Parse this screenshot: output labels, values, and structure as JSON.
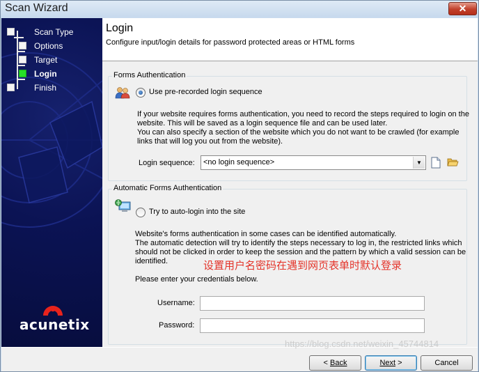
{
  "window": {
    "title": "Scan Wizard",
    "close_glyph": "✕"
  },
  "sidebar": {
    "steps": [
      {
        "label": "Scan Type",
        "active": false
      },
      {
        "label": "Options",
        "active": false
      },
      {
        "label": "Target",
        "active": false
      },
      {
        "label": "Login",
        "active": true
      },
      {
        "label": "Finish",
        "active": false
      }
    ],
    "logo_text": "acunetix"
  },
  "header": {
    "title": "Login",
    "subtitle": "Configure input/login details for password protected areas or HTML forms"
  },
  "forms_auth": {
    "legend": "Forms Authentication",
    "icon": "users-icon",
    "option_label": "Use pre-recorded login sequence",
    "option_selected": true,
    "description": [
      "If your website requires forms authentication, you need to record the steps required to login on the",
      "website. This will be saved as a login sequence file and can be used later.",
      "You can also specify a section of the website which you do not want to be crawled (for example",
      "links that will log you out from the website)."
    ],
    "sequence_label": "Login sequence:",
    "sequence_value": "<no login sequence>",
    "new_icon": "new-file-icon",
    "open_icon": "open-folder-icon"
  },
  "auto_auth": {
    "legend": "Automatic Forms Authentication",
    "icon": "computer-network-icon",
    "option_label": "Try to auto-login into the site",
    "option_selected": false,
    "description": [
      "Website's forms authentication in some cases can be identified automatically.",
      "The automatic detection will try to identify the steps necessary to log in, the restricted links which",
      "should not be clicked in order to keep the session and the pattern by which a valid session can be",
      "identified."
    ],
    "annotation": "设置用户名密码在遇到网页表单时默认登录",
    "credentials_prompt": "Please enter your credentials below.",
    "username_label": "Username:",
    "username_value": "",
    "password_label": "Password:",
    "password_value": ""
  },
  "footer": {
    "back_label": "Back",
    "back_prefix": "< ",
    "next_label": "Next",
    "next_suffix": " >",
    "cancel_label": "Cancel",
    "watermark": "https://blog.csdn.net/weixin_45744814"
  }
}
